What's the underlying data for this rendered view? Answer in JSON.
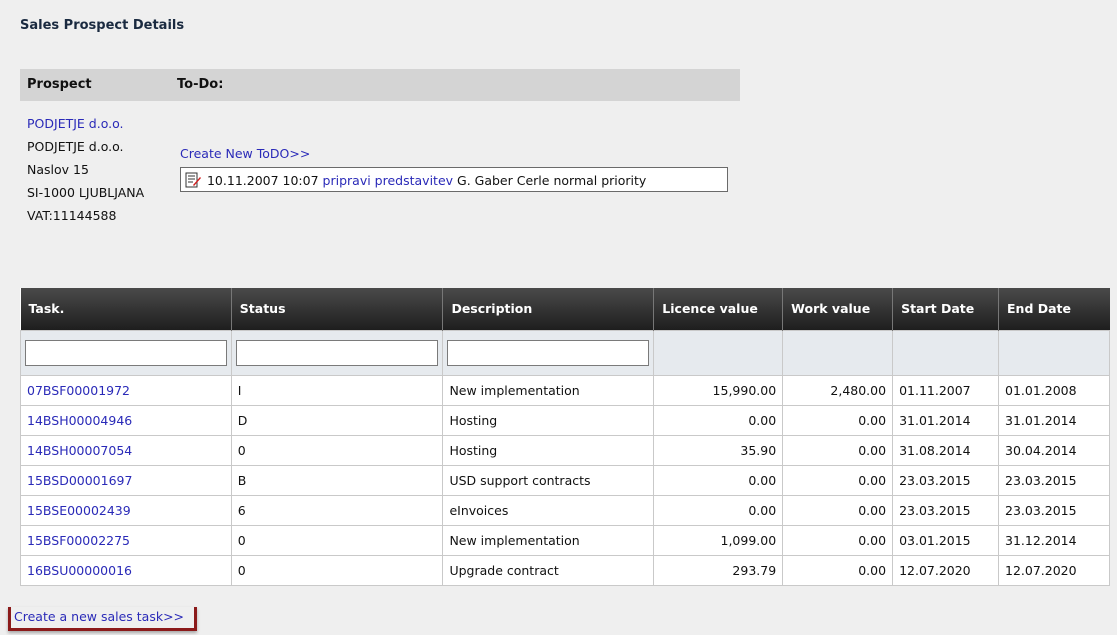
{
  "page": {
    "title": "Sales Prospect Details"
  },
  "header": {
    "prospect": "Prospect",
    "todo": "To-Do:"
  },
  "prospect": {
    "link": "PODJETJE d.o.o.",
    "name": "PODJETJE d.o.o.",
    "address": "Naslov 15",
    "city": "SI-1000 LJUBLJANA",
    "vat": "VAT:11144588"
  },
  "todo": {
    "create_label": "Create New ToDO>>",
    "items": [
      {
        "datetime": "10.11.2007 10:07",
        "title": "pripravi predstavitev",
        "assignee": "G. Gaber Cerle",
        "priority": "normal priority"
      }
    ]
  },
  "tasks": {
    "columns": [
      "Task.",
      "Status",
      "Description",
      "Licence value",
      "Work value",
      "Start Date",
      "End Date"
    ],
    "rows": [
      {
        "task": "07BSF00001972",
        "status": "I",
        "description": "New implementation",
        "licence": "15,990.00",
        "work": "2,480.00",
        "start": "01.11.2007",
        "end": "01.01.2008"
      },
      {
        "task": "14BSH00004946",
        "status": "D",
        "description": "Hosting",
        "licence": "0.00",
        "work": "0.00",
        "start": "31.01.2014",
        "end": "31.01.2014"
      },
      {
        "task": "14BSH00007054",
        "status": "0",
        "description": "Hosting",
        "licence": "35.90",
        "work": "0.00",
        "start": "31.08.2014",
        "end": "30.04.2014"
      },
      {
        "task": "15BSD00001697",
        "status": "B",
        "description": "USD support contracts",
        "licence": "0.00",
        "work": "0.00",
        "start": "23.03.2015",
        "end": "23.03.2015"
      },
      {
        "task": "15BSE00002439",
        "status": "6",
        "description": "eInvoices",
        "licence": "0.00",
        "work": "0.00",
        "start": "23.03.2015",
        "end": "23.03.2015"
      },
      {
        "task": "15BSF00002275",
        "status": "0",
        "description": "New implementation",
        "licence": "1,099.00",
        "work": "0.00",
        "start": "03.01.2015",
        "end": "31.12.2014"
      },
      {
        "task": "16BSU00000016",
        "status": "0",
        "description": "Upgrade contract",
        "licence": "293.79",
        "work": "0.00",
        "start": "12.07.2020",
        "end": "12.07.2020"
      }
    ],
    "create_label": "Create a new sales task>>"
  },
  "colors": {
    "link": "#2a2ab8",
    "header_dark": "#2a2a2a",
    "highlight": "#8b1a1a"
  },
  "icons": {
    "todo": "edit-note-icon"
  }
}
